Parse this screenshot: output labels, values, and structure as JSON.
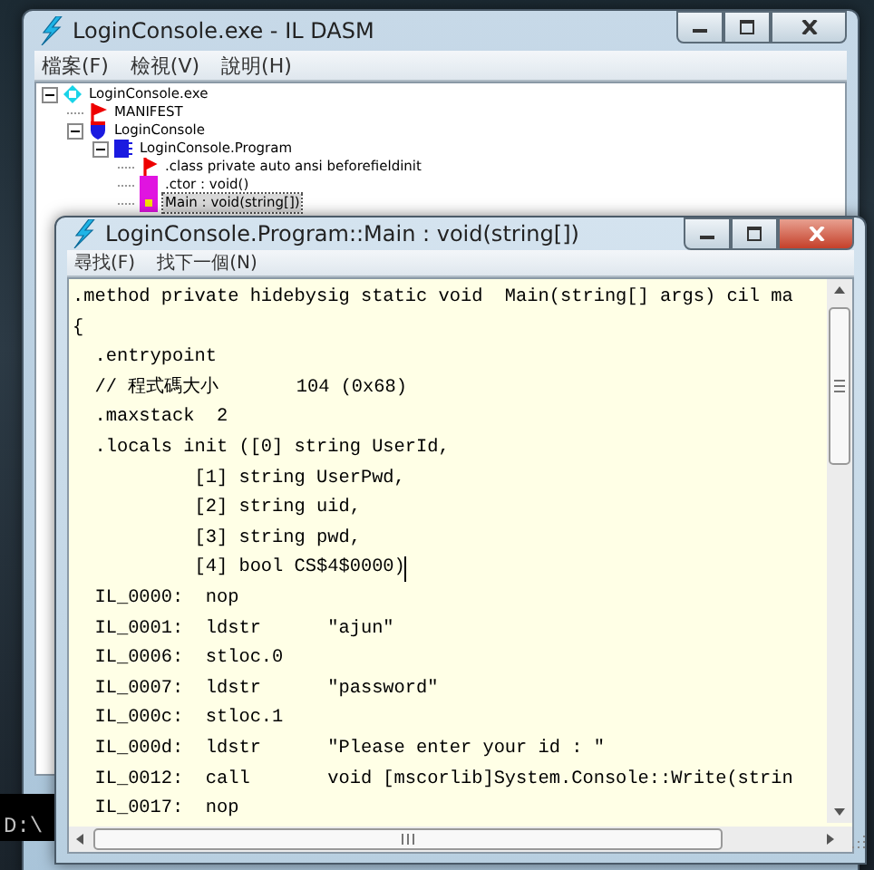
{
  "back_window": {
    "title": "LoginConsole.exe - IL DASM",
    "menu": [
      "檔案(F)",
      "檢視(V)",
      "說明(H)"
    ],
    "tree": [
      {
        "label": "LoginConsole.exe",
        "kind": "assembly",
        "expanded": true,
        "selected": false,
        "children": [
          {
            "label": "MANIFEST",
            "kind": "manifest",
            "selected": false
          },
          {
            "label": "LoginConsole",
            "kind": "namespace",
            "expanded": true,
            "selected": false,
            "children": [
              {
                "label": "LoginConsole.Program",
                "kind": "class",
                "expanded": true,
                "selected": false,
                "children": [
                  {
                    "label": ".class private auto ansi beforefieldinit",
                    "kind": "classinfo",
                    "selected": false
                  },
                  {
                    "label": ".ctor : void()",
                    "kind": "method",
                    "selected": false
                  },
                  {
                    "label": "Main : void(string[])",
                    "kind": "static_method",
                    "selected": true
                  }
                ]
              }
            ]
          }
        ]
      }
    ]
  },
  "console": {
    "prompt": "D:\\"
  },
  "front_window": {
    "title": "LoginConsole.Program::Main : void(string[])",
    "menu": [
      "尋找(F)",
      "找下一個(N)"
    ],
    "code_lines": [
      ".method private hidebysig static void  Main(string[] args) cil ma",
      "{",
      "  .entrypoint",
      "  // 程式碼大小       104 (0x68)",
      "  .maxstack  2",
      "  .locals init ([0] string UserId,",
      "           [1] string UserPwd,",
      "           [2] string uid,",
      "           [3] string pwd,",
      "           [4] bool CS$4$0000)",
      "  IL_0000:  nop",
      "  IL_0001:  ldstr      \"ajun\"",
      "  IL_0006:  stloc.0",
      "  IL_0007:  ldstr      \"password\"",
      "  IL_000c:  stloc.1",
      "  IL_000d:  ldstr      \"Please enter your id : \"",
      "  IL_0012:  call       void [mscorlib]System.Console::Write(strin",
      "  IL_0017:  nop"
    ]
  }
}
